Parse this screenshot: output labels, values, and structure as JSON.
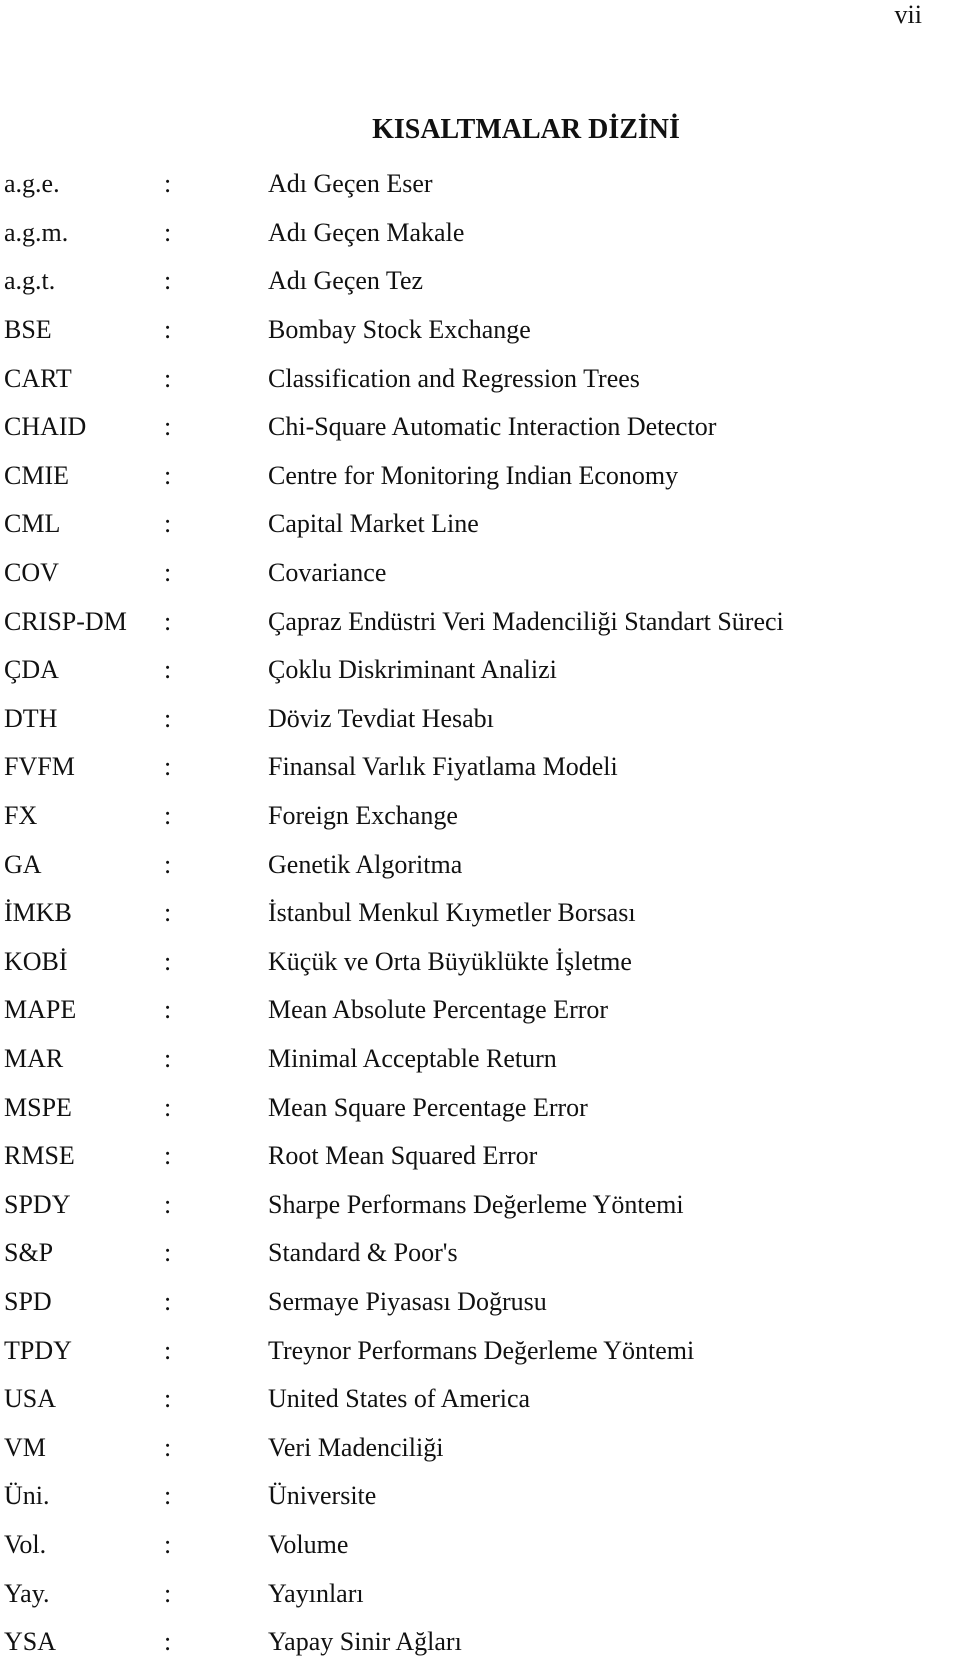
{
  "page_number": "vii",
  "title": "KISALTMALAR DİZİNİ",
  "separator": ":",
  "entries": [
    {
      "abbr": "a.g.e.",
      "definition": "Adı Geçen Eser"
    },
    {
      "abbr": "a.g.m.",
      "definition": "Adı Geçen Makale"
    },
    {
      "abbr": "a.g.t.",
      "definition": "Adı Geçen Tez"
    },
    {
      "abbr": "BSE",
      "definition": "Bombay Stock Exchange"
    },
    {
      "abbr": "CART",
      "definition": "Classification and Regression Trees"
    },
    {
      "abbr": "CHAID",
      "definition": "Chi-Square Automatic Interaction Detector"
    },
    {
      "abbr": "CMIE",
      "definition": "Centre for Monitoring Indian Economy"
    },
    {
      "abbr": "CML",
      "definition": "Capital Market Line"
    },
    {
      "abbr": "COV",
      "definition": "Covariance"
    },
    {
      "abbr": "CRISP-DM",
      "definition": "Çapraz Endüstri Veri Madenciliği Standart Süreci"
    },
    {
      "abbr": "ÇDA",
      "definition": "Çoklu Diskriminant Analizi"
    },
    {
      "abbr": "DTH",
      "definition": "Döviz Tevdiat Hesabı"
    },
    {
      "abbr": "FVFM",
      "definition": "Finansal Varlık Fiyatlama Modeli"
    },
    {
      "abbr": "FX",
      "definition": "Foreign Exchange"
    },
    {
      "abbr": "GA",
      "definition": "Genetik Algoritma"
    },
    {
      "abbr": "İMKB",
      "definition": "İstanbul Menkul Kıymetler Borsası"
    },
    {
      "abbr": "KOBİ",
      "definition": "Küçük ve Orta Büyüklükte İşletme"
    },
    {
      "abbr": "MAPE",
      "definition": "Mean Absolute Percentage Error"
    },
    {
      "abbr": "MAR",
      "definition": "Minimal Acceptable Return"
    },
    {
      "abbr": "MSPE",
      "definition": "Mean Square Percentage Error"
    },
    {
      "abbr": "RMSE",
      "definition": "Root Mean Squared Error"
    },
    {
      "abbr": "SPDY",
      "definition": "Sharpe Performans Değerleme Yöntemi"
    },
    {
      "abbr": "S&P",
      "definition": "Standard & Poor's"
    },
    {
      "abbr": "SPD",
      "definition": "Sermaye Piyasası Doğrusu"
    },
    {
      "abbr": "TPDY",
      "definition": "Treynor Performans Değerleme Yöntemi"
    },
    {
      "abbr": "USA",
      "definition": "United States of America"
    },
    {
      "abbr": "VM",
      "definition": "Veri Madenciliği"
    },
    {
      "abbr": "Üni.",
      "definition": "Üniversite"
    },
    {
      "abbr": "Vol.",
      "definition": "Volume"
    },
    {
      "abbr": "Yay.",
      "definition": "Yayınları"
    },
    {
      "abbr": "YSA",
      "definition": "Yapay Sinir Ağları"
    }
  ]
}
